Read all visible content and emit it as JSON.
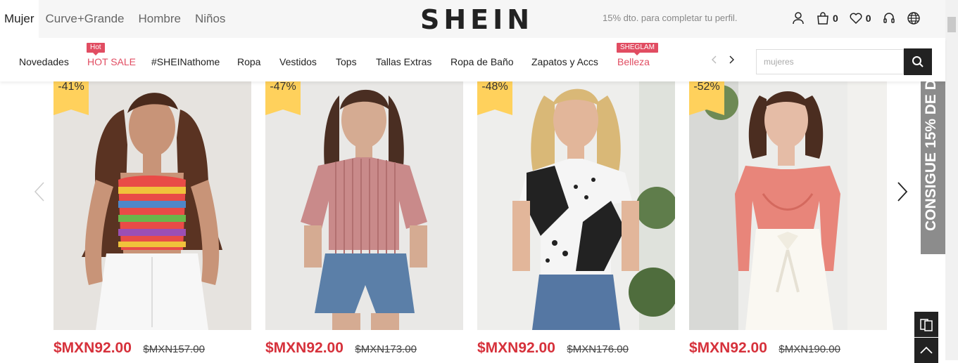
{
  "header": {
    "gender_tabs": [
      "Mujer",
      "Curve+Grande",
      "Hombre",
      "Niños"
    ],
    "logo": "SHEIN",
    "promo": "15% dto. para completar tu perfil.",
    "cart_count": "0",
    "wishlist_count": "0"
  },
  "nav": {
    "items": [
      "Novedades",
      "HOT SALE",
      "#SHEINathome",
      "Ropa",
      "Vestidos",
      "Tops",
      "Tallas Extras",
      "Ropa de Baño",
      "Zapatos y Accs",
      "Belleza"
    ],
    "badge_hot": "Hot",
    "badge_sheglam": "SHEGLAM",
    "search_placeholder": "mujeres"
  },
  "products": [
    {
      "discount": "-41%",
      "price": "$MXN92.00",
      "old_price": "$MXN157.00"
    },
    {
      "discount": "-47%",
      "price": "$MXN92.00",
      "old_price": "$MXN173.00"
    },
    {
      "discount": "-48%",
      "price": "$MXN92.00",
      "old_price": "$MXN176.00"
    },
    {
      "discount": "-52%",
      "price": "$MXN92.00",
      "old_price": "$MXN190.00"
    }
  ],
  "side_promo": "CONSIGUE 15% DE D",
  "colors": {
    "accent_red": "#d6313b",
    "nav_red": "#e14d62",
    "discount_yellow": "#ffd15c",
    "dark": "#222222"
  },
  "icons": [
    "user-icon",
    "bag-icon",
    "heart-icon",
    "headset-icon",
    "globe-icon",
    "search-icon",
    "chevron-left-icon",
    "chevron-right-icon",
    "chevron-up-icon",
    "coupon-icon"
  ]
}
